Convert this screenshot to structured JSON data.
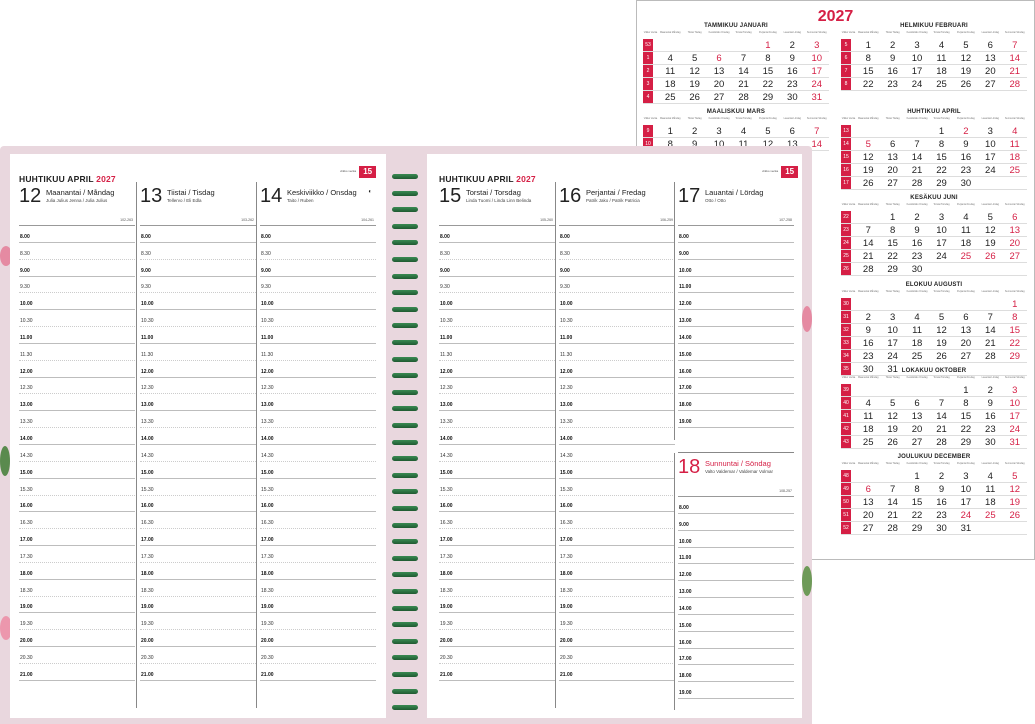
{
  "year_calendar": {
    "year": "2027",
    "weekday_short": [
      "Viikko Vecka",
      "Maanantai Måndag",
      "Tiistai Tisdag",
      "Keskiviikko Onsdag",
      "Torstai Torsdag",
      "Perjantai Fredag",
      "Lauantai Lördag",
      "Sunnuntai Söndag"
    ],
    "months": [
      {
        "name": "TAMMIKUU JANUARI",
        "weeks": [
          [
            "53",
            "",
            "",
            "",
            "",
            "1",
            "2",
            "3"
          ],
          [
            "1",
            "4",
            "5",
            "6",
            "7",
            "8",
            "9",
            "10"
          ],
          [
            "2",
            "11",
            "12",
            "13",
            "14",
            "15",
            "16",
            "17"
          ],
          [
            "3",
            "18",
            "19",
            "20",
            "21",
            "22",
            "23",
            "24"
          ],
          [
            "4",
            "25",
            "26",
            "27",
            "28",
            "29",
            "30",
            "31"
          ]
        ]
      },
      {
        "name": "HELMIKUU FEBRUARI",
        "weeks": [
          [
            "5",
            "1",
            "2",
            "3",
            "4",
            "5",
            "6",
            "7"
          ],
          [
            "6",
            "8",
            "9",
            "10",
            "11",
            "12",
            "13",
            "14"
          ],
          [
            "7",
            "15",
            "16",
            "17",
            "18",
            "19",
            "20",
            "21"
          ],
          [
            "8",
            "22",
            "23",
            "24",
            "25",
            "26",
            "27",
            "28"
          ]
        ]
      },
      {
        "name": "MAALISKUU MARS",
        "weeks": [
          [
            "9",
            "1",
            "2",
            "3",
            "4",
            "5",
            "6",
            "7"
          ],
          [
            "10",
            "8",
            "9",
            "10",
            "11",
            "12",
            "13",
            "14"
          ]
        ]
      },
      {
        "name": "HUHTIKUU APRIL",
        "weeks": [
          [
            "13",
            "",
            "",
            "",
            "1",
            "2",
            "3",
            "4"
          ],
          [
            "14",
            "5",
            "6",
            "7",
            "8",
            "9",
            "10",
            "11"
          ],
          [
            "15",
            "12",
            "13",
            "14",
            "15",
            "16",
            "17",
            "18"
          ],
          [
            "16",
            "19",
            "20",
            "21",
            "22",
            "23",
            "24",
            "25"
          ],
          [
            "17",
            "26",
            "27",
            "28",
            "29",
            "30",
            "",
            ""
          ]
        ]
      },
      {
        "name": "KESÄKUU JUNI",
        "weeks": [
          [
            "22",
            "",
            "1",
            "2",
            "3",
            "4",
            "5",
            "6"
          ],
          [
            "23",
            "7",
            "8",
            "9",
            "10",
            "11",
            "12",
            "13"
          ],
          [
            "24",
            "14",
            "15",
            "16",
            "17",
            "18",
            "19",
            "20"
          ],
          [
            "25",
            "21",
            "22",
            "23",
            "24",
            "25",
            "26",
            "27"
          ],
          [
            "26",
            "28",
            "29",
            "30",
            "",
            "",
            "",
            ""
          ]
        ]
      },
      {
        "name": "ELOKUU AUGUSTI",
        "weeks": [
          [
            "30",
            "",
            "",
            "",
            "",
            "",
            "",
            "1"
          ],
          [
            "31",
            "2",
            "3",
            "4",
            "5",
            "6",
            "7",
            "8"
          ],
          [
            "32",
            "9",
            "10",
            "11",
            "12",
            "13",
            "14",
            "15"
          ],
          [
            "33",
            "16",
            "17",
            "18",
            "19",
            "20",
            "21",
            "22"
          ],
          [
            "34",
            "23",
            "24",
            "25",
            "26",
            "27",
            "28",
            "29"
          ],
          [
            "35",
            "30",
            "31",
            "",
            "",
            "",
            "",
            ""
          ]
        ]
      },
      {
        "name": "LOKAKUU OKTOBER",
        "weeks": [
          [
            "39",
            "",
            "",
            "",
            "",
            "1",
            "2",
            "3"
          ],
          [
            "40",
            "4",
            "5",
            "6",
            "7",
            "8",
            "9",
            "10"
          ],
          [
            "41",
            "11",
            "12",
            "13",
            "14",
            "15",
            "16",
            "17"
          ],
          [
            "42",
            "18",
            "19",
            "20",
            "21",
            "22",
            "23",
            "24"
          ],
          [
            "43",
            "25",
            "26",
            "27",
            "28",
            "29",
            "30",
            "31"
          ]
        ]
      },
      {
        "name": "JOULUKUU DECEMBER",
        "weeks": [
          [
            "48",
            "",
            "",
            "1",
            "2",
            "3",
            "4",
            "5"
          ],
          [
            "49",
            "6",
            "7",
            "8",
            "9",
            "10",
            "11",
            "12"
          ],
          [
            "50",
            "13",
            "14",
            "15",
            "16",
            "17",
            "18",
            "19"
          ],
          [
            "51",
            "20",
            "21",
            "22",
            "23",
            "24",
            "25",
            "26"
          ],
          [
            "52",
            "27",
            "28",
            "29",
            "30",
            "31",
            "",
            ""
          ]
        ]
      }
    ]
  },
  "planner": {
    "left_title": "HUHTIKUU APRIL",
    "right_title": "HUHTIKUU APRIL",
    "year": "2027",
    "week_label": "viikko vecka",
    "week_number": "15",
    "days": [
      {
        "num": "12",
        "name": "Maanantai / Måndag",
        "names": "Julia Julius Jenna / Julia Julius",
        "dofy": "102-263"
      },
      {
        "num": "13",
        "name": "Tiistai / Tisdag",
        "names": "Tellervo / Eli Edla",
        "dofy": "103-262"
      },
      {
        "num": "14",
        "name": "Keskiviikko / Onsdag",
        "names": "Taito / Ruben",
        "dofy": "104-261"
      },
      {
        "num": "15",
        "name": "Torstai / Torsdag",
        "names": "Linda Tuomi / Linda Linn Belinda",
        "dofy": "105-260"
      },
      {
        "num": "16",
        "name": "Perjantai / Fredag",
        "names": "Patrik Jako / Patrik Patricia",
        "dofy": "106-259"
      },
      {
        "num": "17",
        "name": "Lauantai / Lördag",
        "names": "Otto / Otto",
        "dofy": "107-258"
      }
    ],
    "sunday": {
      "num": "18",
      "name": "Sunnuntai / Söndag",
      "names": "Valto Valdemar / Valdemar Volmar",
      "dofy": "108-257"
    },
    "times": [
      "8.00",
      "8.30",
      "9.00",
      "9.30",
      "10.00",
      "10.30",
      "11.00",
      "11.30",
      "12.00",
      "12.30",
      "13.00",
      "13.30",
      "14.00",
      "14.30",
      "15.00",
      "15.30",
      "16.00",
      "16.30",
      "17.00",
      "17.30",
      "18.00",
      "18.30",
      "19.00",
      "19.30",
      "20.00",
      "20.30",
      "21.00"
    ],
    "saturday_times": [
      "8.00",
      "9.00",
      "10.00",
      "11.00",
      "12.00",
      "13.00",
      "14.00",
      "15.00",
      "16.00",
      "17.00",
      "18.00",
      "19.00"
    ],
    "sunday_times": [
      "8.00",
      "9.00",
      "10.00",
      "11.00",
      "12.00",
      "13.00",
      "14.00",
      "15.00",
      "16.00",
      "17.00",
      "18.00",
      "19.00"
    ]
  }
}
